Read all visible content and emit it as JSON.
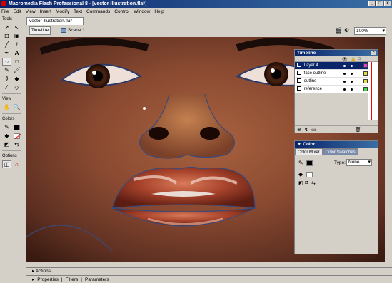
{
  "window": {
    "title": "Macromedia Flash Professional 8 - [vector illustration.fla*]",
    "min": "_",
    "max": "□",
    "close": "×"
  },
  "menu": [
    "File",
    "Edit",
    "View",
    "Insert",
    "Modify",
    "Text",
    "Commands",
    "Control",
    "Window",
    "Help"
  ],
  "tools_panel": {
    "tools_label": "Tools",
    "view_label": "View",
    "colors_label": "Colors",
    "options_label": "Options"
  },
  "document": {
    "tab_label": "vector illustration.fla*",
    "timeline_button": "Timeline",
    "scene_label": "Scene 1",
    "zoom": "100%"
  },
  "timeline": {
    "title": "Timeline",
    "layers": [
      {
        "name": "Layer 4",
        "selected": true,
        "color": "#e040e0"
      },
      {
        "name": "face outline",
        "selected": false,
        "color": "#e0e040"
      },
      {
        "name": "outline",
        "selected": false,
        "color": "#e0e040"
      },
      {
        "name": "reference",
        "selected": false,
        "color": "#40e040"
      }
    ]
  },
  "color_panel": {
    "title": "Color",
    "tab_mixer": "Color Mixer",
    "tab_swatches": "Color Swatches",
    "type_label": "Type:",
    "type_value": "None"
  },
  "bottom": {
    "actions": "Actions",
    "properties": "Properties",
    "filters": "Filters",
    "parameters": "Parameters"
  }
}
